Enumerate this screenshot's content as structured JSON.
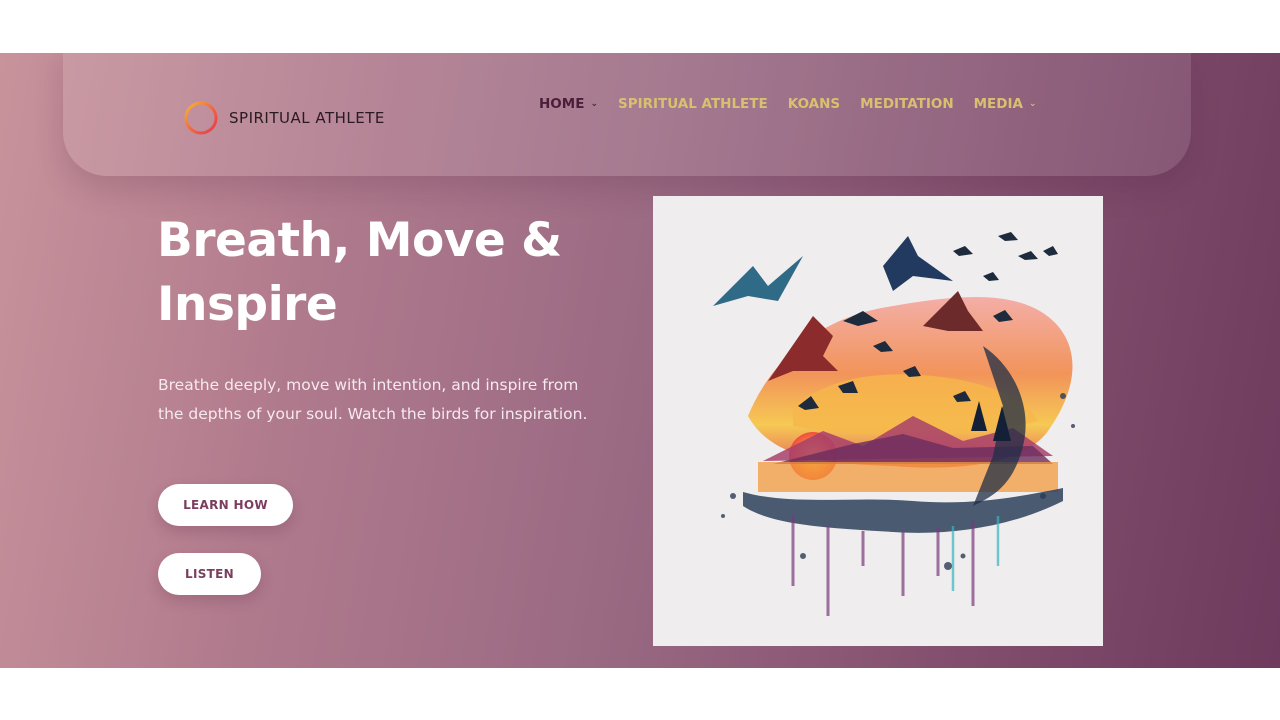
{
  "site": {
    "logo_text": "SPIRITUAL ATHLETE",
    "logo_icon": "ring-icon"
  },
  "nav": {
    "items": [
      {
        "label": "HOME",
        "has_dropdown": true
      },
      {
        "label": "SPIRITUAL ATHLETE",
        "has_dropdown": false
      },
      {
        "label": "KOANS",
        "has_dropdown": false
      },
      {
        "label": "MEDITATION",
        "has_dropdown": false
      },
      {
        "label": "MEDIA",
        "has_dropdown": true
      }
    ],
    "dropdown_icon": "⌄"
  },
  "hero": {
    "title": "Breath, Move & Inspire",
    "description": "Breathe deeply, move with intention, and inspire from the depths of your soul. Watch the birds for inspiration.",
    "buttons": {
      "learn_how": "LEARN HOW",
      "listen": "LISTEN"
    }
  },
  "colors": {
    "accent_gold": "#d8c070",
    "nav_dark": "#4a1f3a",
    "gradient_start": "#c8939b",
    "gradient_end": "#6e3a5d",
    "button_text": "#7b3e5f"
  }
}
